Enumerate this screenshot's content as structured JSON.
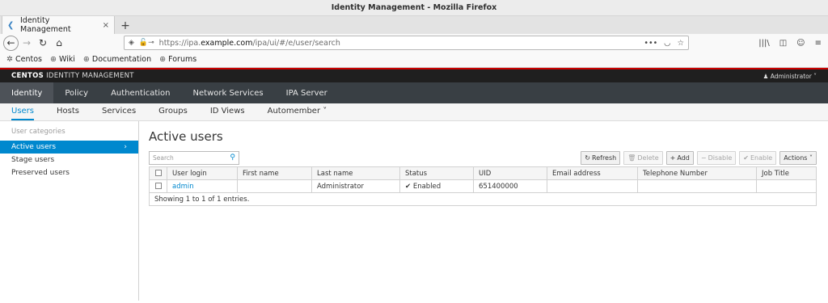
{
  "window": {
    "title": "Identity Management - Mozilla Firefox"
  },
  "tab": {
    "label": "Identity Management",
    "close": "×",
    "new_tab": "+"
  },
  "browser": {
    "url_prefix": "https://ipa.",
    "url_domain": "example.com",
    "url_path": "/ipa/ui/#/e/user/search",
    "more_menu": "•••",
    "bookmarks": [
      "Centos",
      "Wiki",
      "Documentation",
      "Forums"
    ]
  },
  "masthead": {
    "brand_bold": "CENTOS",
    "brand_rest": " IDENTITY MANAGEMENT",
    "user": "Administrator"
  },
  "topnav": [
    "Identity",
    "Policy",
    "Authentication",
    "Network Services",
    "IPA Server"
  ],
  "subnav": [
    "Users",
    "Hosts",
    "Services",
    "Groups",
    "ID Views",
    "Automember"
  ],
  "sidebar": {
    "category": "User categories",
    "items": [
      "Active users",
      "Stage users",
      "Preserved users"
    ]
  },
  "page": {
    "title": "Active users"
  },
  "search": {
    "placeholder": "Search"
  },
  "actions": {
    "refresh": "Refresh",
    "delete": "Delete",
    "add": "Add",
    "disable": "Disable",
    "enable": "Enable",
    "actions": "Actions"
  },
  "table": {
    "columns": [
      "User login",
      "First name",
      "Last name",
      "Status",
      "UID",
      "Email address",
      "Telephone Number",
      "Job Title"
    ],
    "rows": [
      {
        "login": "admin",
        "first": "",
        "last": "Administrator",
        "status": "Enabled",
        "uid": "651400000",
        "email": "",
        "phone": "",
        "job": ""
      }
    ],
    "footer": "Showing 1 to 1 of 1 entries."
  },
  "colors": {
    "accent": "#0088ce",
    "masthead": "#1f1f1f",
    "topnav": "#393f44",
    "redline": "#cc0000"
  }
}
